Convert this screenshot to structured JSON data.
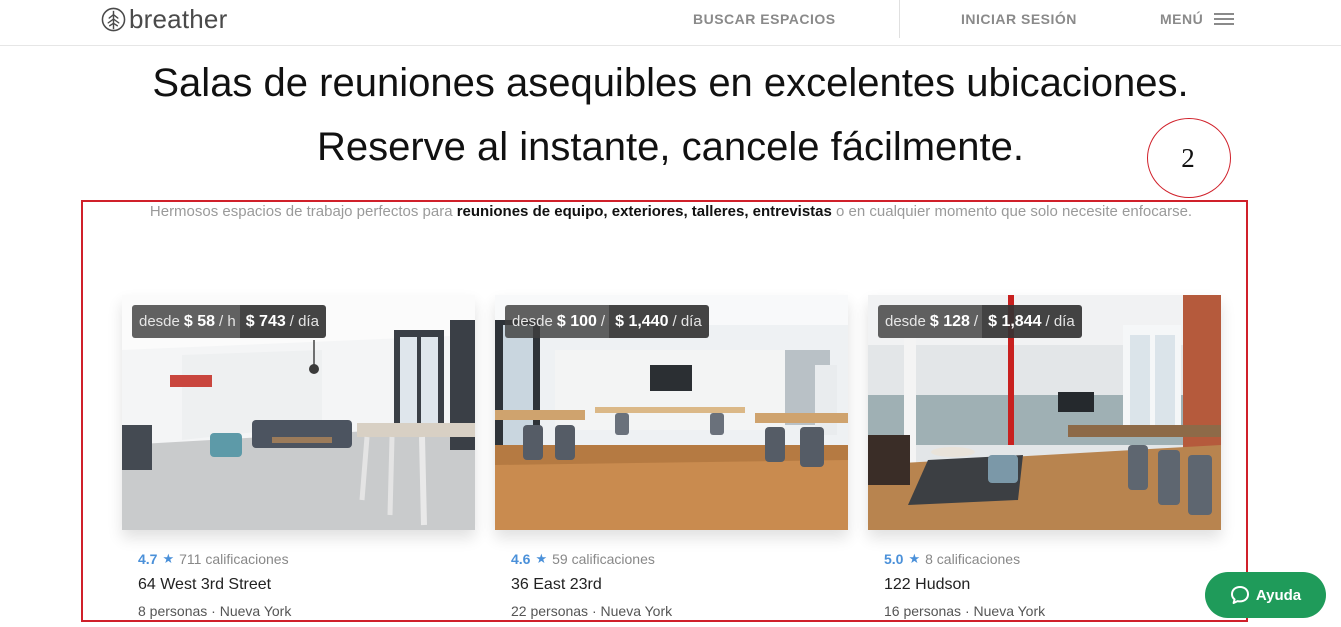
{
  "header": {
    "logo_text": "breather",
    "nav": {
      "search": "BUSCAR ESPACIOS",
      "login": "INICIAR SESIÓN",
      "menu": "MENÚ"
    }
  },
  "hero": {
    "line1": "Salas de reuniones asequibles en excelentes ubicaciones.",
    "line2": "Reserve al instante, cancele fácilmente."
  },
  "annotation": {
    "number": "2",
    "color": "#d0202a"
  },
  "subtitle": {
    "prefix": "Hermosos espacios de trabajo perfectos para ",
    "bold": "reuniones de equipo, exteriores, talleres, entrevistas",
    "suffix": " o en cualquier momento que solo necesite enfocarse."
  },
  "listings": [
    {
      "price_from_label": "desde",
      "price_hour": "$ 58",
      "hour_sep": "/ h",
      "price_day": "$ 743",
      "day_unit": "/ día",
      "rating": "4.7",
      "ratings_count": "711 calificaciones",
      "title": "64 West 3rd Street",
      "capacity": "8 personas",
      "city": "Nueva York"
    },
    {
      "price_from_label": "desde",
      "price_hour": "$ 100",
      "hour_sep": "/",
      "price_day": "$ 1,440",
      "day_unit": "/ día",
      "rating": "4.6",
      "ratings_count": "59 calificaciones",
      "title": "36 East 23rd",
      "capacity": "22 personas",
      "city": "Nueva York"
    },
    {
      "price_from_label": "desde",
      "price_hour": "$ 128",
      "hour_sep": "/",
      "price_day": "$ 1,844",
      "day_unit": "/ día",
      "rating": "5.0",
      "ratings_count": "8 calificaciones",
      "title": "122 Hudson",
      "capacity": "16 personas",
      "city": "Nueva York"
    }
  ],
  "help": {
    "label": "Ayuda",
    "icon": "chat-bubble-icon",
    "color": "#1f9b5a"
  },
  "colors": {
    "accent_blue": "#4a90d9",
    "nav_gray": "#8a8a8a"
  }
}
